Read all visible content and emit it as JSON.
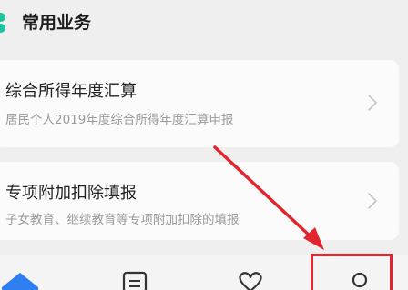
{
  "section": {
    "title": "常用业务"
  },
  "cards": [
    {
      "title": "综合所得年度汇算",
      "desc": "居民个人2019年度综合所得年度汇算申报"
    },
    {
      "title": "专项附加扣除填报",
      "desc": "子女教育、继续教育等专项附加扣除的填报"
    }
  ],
  "tabbar": {
    "items": [
      {
        "icon": "home-icon"
      },
      {
        "icon": "document-icon"
      },
      {
        "icon": "heart-icon"
      },
      {
        "icon": "person-icon"
      }
    ]
  },
  "colors": {
    "accent": "#1ec3a0",
    "annotation": "#e2262f",
    "tab_active": "#2f7ef2",
    "background": "#efefef"
  }
}
